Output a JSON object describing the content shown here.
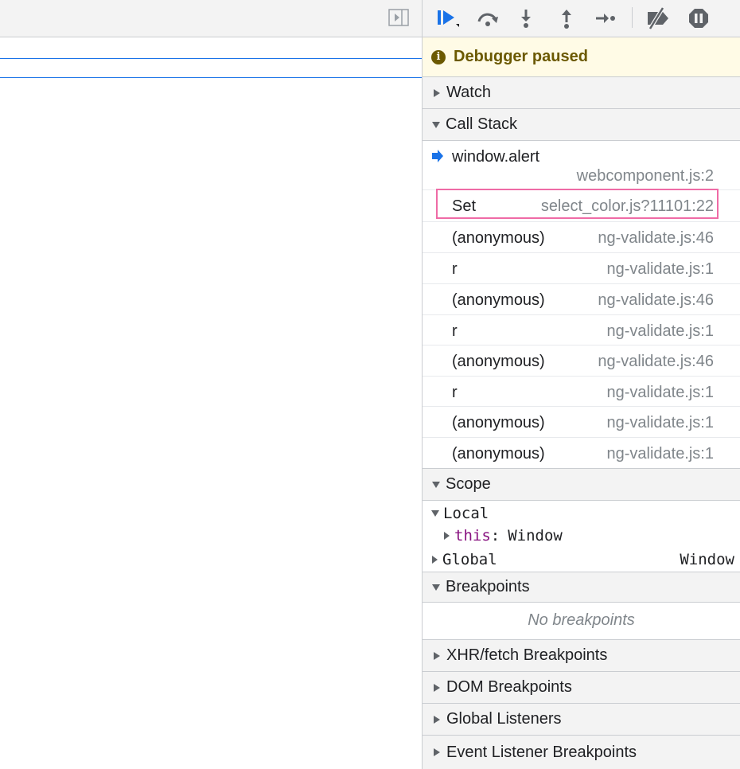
{
  "toolbar": {
    "buttons": [
      "resume-icon",
      "step-over-icon",
      "step-into-icon",
      "step-out-icon",
      "step-icon",
      "deactivate-breakpoints-icon",
      "pause-on-exceptions-icon"
    ],
    "accent": "#1a73e8"
  },
  "status": {
    "text": "Debugger paused",
    "icon": "info-icon"
  },
  "sections": {
    "watch": "Watch",
    "call_stack": "Call Stack",
    "scope": "Scope",
    "breakpoints": "Breakpoints",
    "xhr": "XHR/fetch Breakpoints",
    "dom": "DOM Breakpoints",
    "global_listeners": "Global Listeners",
    "event_listener": "Event Listener Breakpoints"
  },
  "call_stack": [
    {
      "name": "window.alert",
      "location": "webcomponent.js:2"
    },
    {
      "name": "Set",
      "location": "select_color.js?11101:22"
    },
    {
      "name": "(anonymous)",
      "location": "ng-validate.js:46"
    },
    {
      "name": "r",
      "location": "ng-validate.js:1"
    },
    {
      "name": "(anonymous)",
      "location": "ng-validate.js:46"
    },
    {
      "name": "r",
      "location": "ng-validate.js:1"
    },
    {
      "name": "(anonymous)",
      "location": "ng-validate.js:46"
    },
    {
      "name": "r",
      "location": "ng-validate.js:1"
    },
    {
      "name": "(anonymous)",
      "location": "ng-validate.js:1"
    },
    {
      "name": "(anonymous)",
      "location": "ng-validate.js:1"
    }
  ],
  "scope": {
    "local_label": "Local",
    "this_key": "this",
    "this_sep": ":",
    "this_value": "Window",
    "global_label": "Global",
    "global_value": "Window"
  },
  "breakpoints": {
    "empty_text": "No breakpoints"
  }
}
